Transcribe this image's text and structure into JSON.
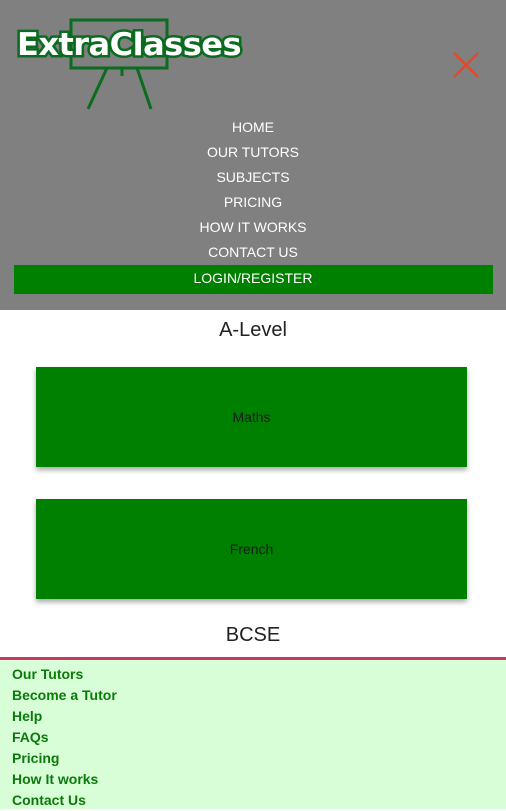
{
  "brand": {
    "logo_text": "ExtraClasses",
    "accent_color": "#008000",
    "close_color": "#e04a2a"
  },
  "nav": {
    "items": [
      {
        "label": "HOME"
      },
      {
        "label": "OUR TUTORS"
      },
      {
        "label": "SUBJECTS"
      },
      {
        "label": "PRICING"
      },
      {
        "label": "HOW IT WORKS"
      },
      {
        "label": "CONTACT US"
      }
    ],
    "login_label": "LOGIN/REGISTER"
  },
  "main": {
    "sections": [
      {
        "title": "A-Level",
        "subjects": [
          "Maths",
          "French"
        ]
      },
      {
        "title": "BCSE"
      }
    ]
  },
  "footer": {
    "links": [
      "Our Tutors",
      "Become a Tutor",
      "Help",
      "FAQs",
      "Pricing",
      "How It works",
      "Contact Us"
    ]
  }
}
